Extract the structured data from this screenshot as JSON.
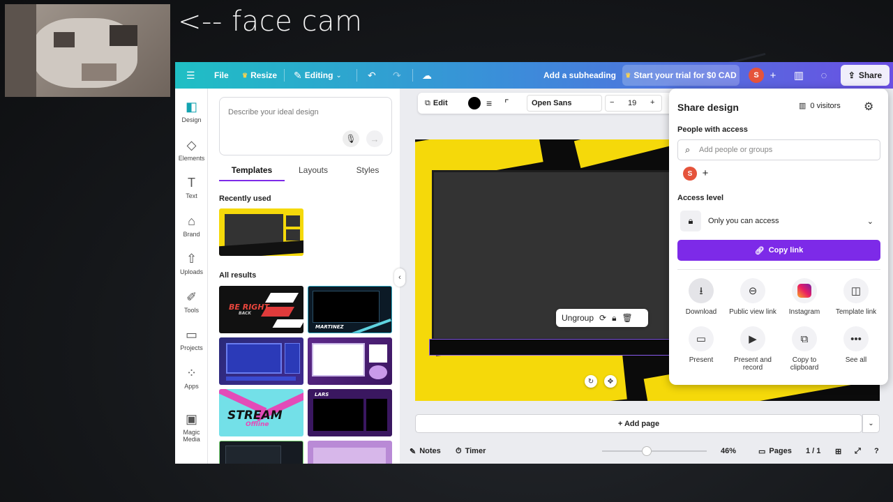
{
  "overlay": {
    "facecam_label": "<-- face cam"
  },
  "topbar": {
    "menu_icon": "hamburger-icon",
    "file": "File",
    "resize": "Resize",
    "editing": "Editing",
    "subheading": "Add a subheading",
    "trial": "Start your trial for $0 CAD",
    "avatar_initial": "S",
    "share": "Share",
    "brand_gradient": [
      "#1fbfc4",
      "#3a8fd9",
      "#6b4fe3"
    ]
  },
  "rail": {
    "items": [
      {
        "label": "Design",
        "icon": "design-icon"
      },
      {
        "label": "Elements",
        "icon": "elements-icon"
      },
      {
        "label": "Text",
        "icon": "text-icon"
      },
      {
        "label": "Brand",
        "icon": "brand-icon"
      },
      {
        "label": "Uploads",
        "icon": "upload-icon"
      },
      {
        "label": "Tools",
        "icon": "tools-icon"
      },
      {
        "label": "Projects",
        "icon": "folder-icon"
      },
      {
        "label": "Apps",
        "icon": "apps-icon"
      },
      {
        "label": "Magic Media",
        "icon": "magic-media-icon"
      }
    ]
  },
  "panel": {
    "prompt_placeholder": "Describe your ideal design",
    "tabs": [
      "Templates",
      "Layouts",
      "Styles"
    ],
    "recently_used": "Recently used",
    "all_results": "All results",
    "thumb_texts": {
      "be_right_back": "BE RIGHT",
      "back_small": "BACK",
      "martinez": "MARTINEZ",
      "stream": "STREAM",
      "offline": "Offline",
      "lars": "LARS"
    }
  },
  "toolbar": {
    "edit": "Edit",
    "font": "Open Sans",
    "font_size": "19",
    "minus": "−",
    "plus": "+"
  },
  "canvas": {
    "ungroup": "Ungroup",
    "accent": "#f5d90a"
  },
  "add_page": "+ Add page",
  "footer": {
    "notes": "Notes",
    "timer": "Timer",
    "zoom": "46%",
    "pages": "Pages",
    "page_count": "1 / 1",
    "zoom_level": 0.4
  },
  "share_panel": {
    "title": "Share design",
    "visitors": "0 visitors",
    "people_with_access": "People with access",
    "add_placeholder": "Add people or groups",
    "avatar_initial": "S",
    "access_level": "Access level",
    "access_value": "Only you can access",
    "copy_link": "Copy link",
    "copy_color": "#7d2ae8",
    "options": [
      {
        "label": "Download",
        "icon": "download-icon"
      },
      {
        "label": "Public view link",
        "icon": "link-icon"
      },
      {
        "label": "Instagram",
        "icon": "instagram-icon"
      },
      {
        "label": "Template link",
        "icon": "template-link-icon"
      },
      {
        "label": "Present",
        "icon": "present-icon"
      },
      {
        "label": "Present and record",
        "icon": "video-record-icon"
      },
      {
        "label": "Copy to clipboard",
        "icon": "clipboard-icon"
      },
      {
        "label": "See all",
        "icon": "more-icon"
      }
    ]
  }
}
